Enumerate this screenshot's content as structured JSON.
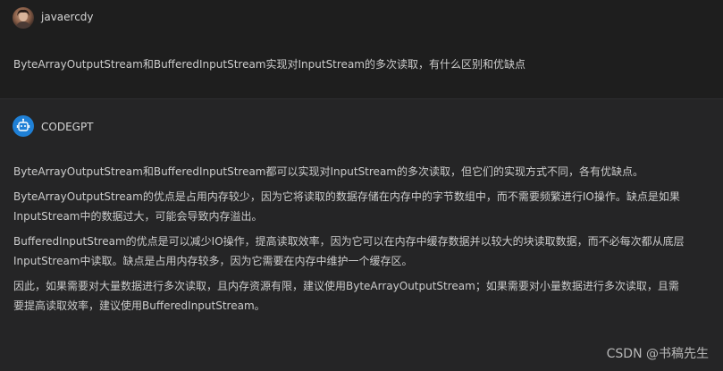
{
  "user": {
    "name": "javaercdy",
    "message": "ByteArrayOutputStream和BufferedInputStream实现对InputStream的多次读取，有什么区别和优缺点"
  },
  "bot": {
    "name": "CODEGPT",
    "accent_color": "#1f80d6",
    "paragraphs": [
      {
        "lines": [
          "ByteArrayOutputStream和BufferedInputStream都可以实现对InputStream的多次读取，但它们的实现方式不同，各有优缺点。"
        ]
      },
      {
        "lines": [
          "ByteArrayOutputStream的优点是占用内存较少，因为它将读取的数据存储在内存中的字节数组中，而不需要频繁进行IO操作。缺点是如果",
          "InputStream中的数据过大，可能会导致内存溢出。"
        ]
      },
      {
        "lines": [
          "BufferedInputStream的优点是可以减少IO操作，提高读取效率，因为它可以在内存中缓存数据并以较大的块读取数据，而不必每次都从底层",
          "InputStream中读取。缺点是占用内存较多，因为它需要在内存中维护一个缓存区。"
        ]
      },
      {
        "lines": [
          "因此，如果需要对大量数据进行多次读取，且内存资源有限，建议使用ByteArrayOutputStream；如果需要对小量数据进行多次读取，且需",
          "要提高读取效率，建议使用BufferedInputStream。"
        ]
      }
    ]
  },
  "watermark": "CSDN @书稿先生"
}
